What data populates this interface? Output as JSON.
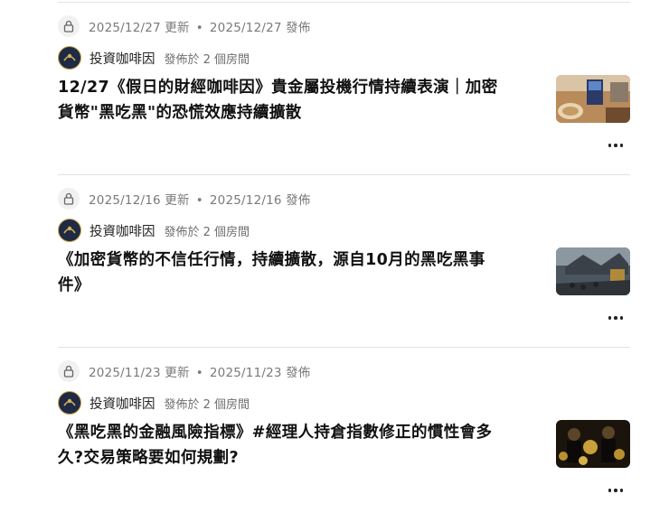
{
  "posts": [
    {
      "updated": "2025/12/27 更新",
      "separator": "•",
      "published": "2025/12/27 發佈",
      "author": "投資咖啡因",
      "rooms": "發佈於 2 個房間",
      "title_lines": [
        "12/27《假日的財經咖啡因》貴金屬投機行情持續表演｜加密",
        "貨幣\"黑吃黑\"的恐慌效應持續擴散"
      ],
      "thumbnail_icon": "cafe-interior-thumbnail"
    },
    {
      "updated": "2025/12/16 更新",
      "separator": "•",
      "published": "2025/12/16 發佈",
      "author": "投資咖啡因",
      "rooms": "發佈於 2 個房間",
      "title_lines": [
        "《加密貨幣的不信任行情，持續擴散，源自10月的黑吃黑事",
        "件》"
      ],
      "thumbnail_icon": "battle-scene-thumbnail"
    },
    {
      "updated": "2025/11/23 更新",
      "separator": "•",
      "published": "2025/11/23 發佈",
      "author": "投資咖啡因",
      "rooms": "發佈於 2 個房間",
      "title_lines": [
        "《黑吃黑的金融風險指標》#經理人持倉指數修正的慣性會多",
        "久?交易策略要如何規劃?"
      ],
      "thumbnail_icon": "gold-coins-men-thumbnail"
    }
  ],
  "colors": {
    "divider": "#e3e3e3",
    "meta": "#7a7a7a",
    "title": "#111111"
  }
}
